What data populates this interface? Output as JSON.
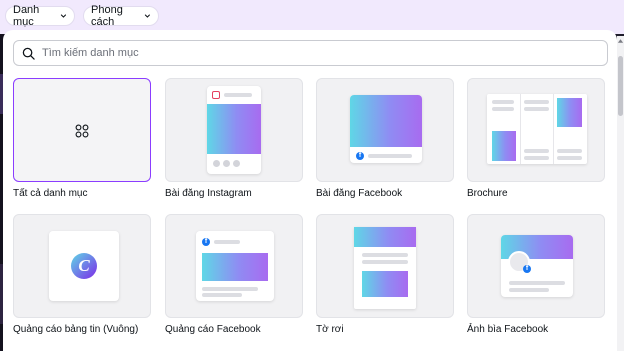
{
  "topbar": {
    "category_label": "Danh mục",
    "style_label": "Phong cách"
  },
  "search": {
    "placeholder": "Tìm kiếm danh mục"
  },
  "cards": [
    {
      "label": "Tất cả danh mục"
    },
    {
      "label": "Bài đăng Instagram"
    },
    {
      "label": "Bài đăng Facebook"
    },
    {
      "label": "Brochure"
    },
    {
      "label": "Quảng cáo bảng tin (Vuông)"
    },
    {
      "label": "Quảng cáo Facebook"
    },
    {
      "label": "Tờ rơi"
    },
    {
      "label": "Ảnh bìa Facebook"
    }
  ],
  "icons": {
    "canva_letter": "C",
    "facebook_letter": "f"
  },
  "colors": {
    "accent": "#8b3dff",
    "topbar_bg": "#f1e9fd",
    "gradient_start": "#5fd7e6",
    "gradient_end": "#a86bf0"
  }
}
